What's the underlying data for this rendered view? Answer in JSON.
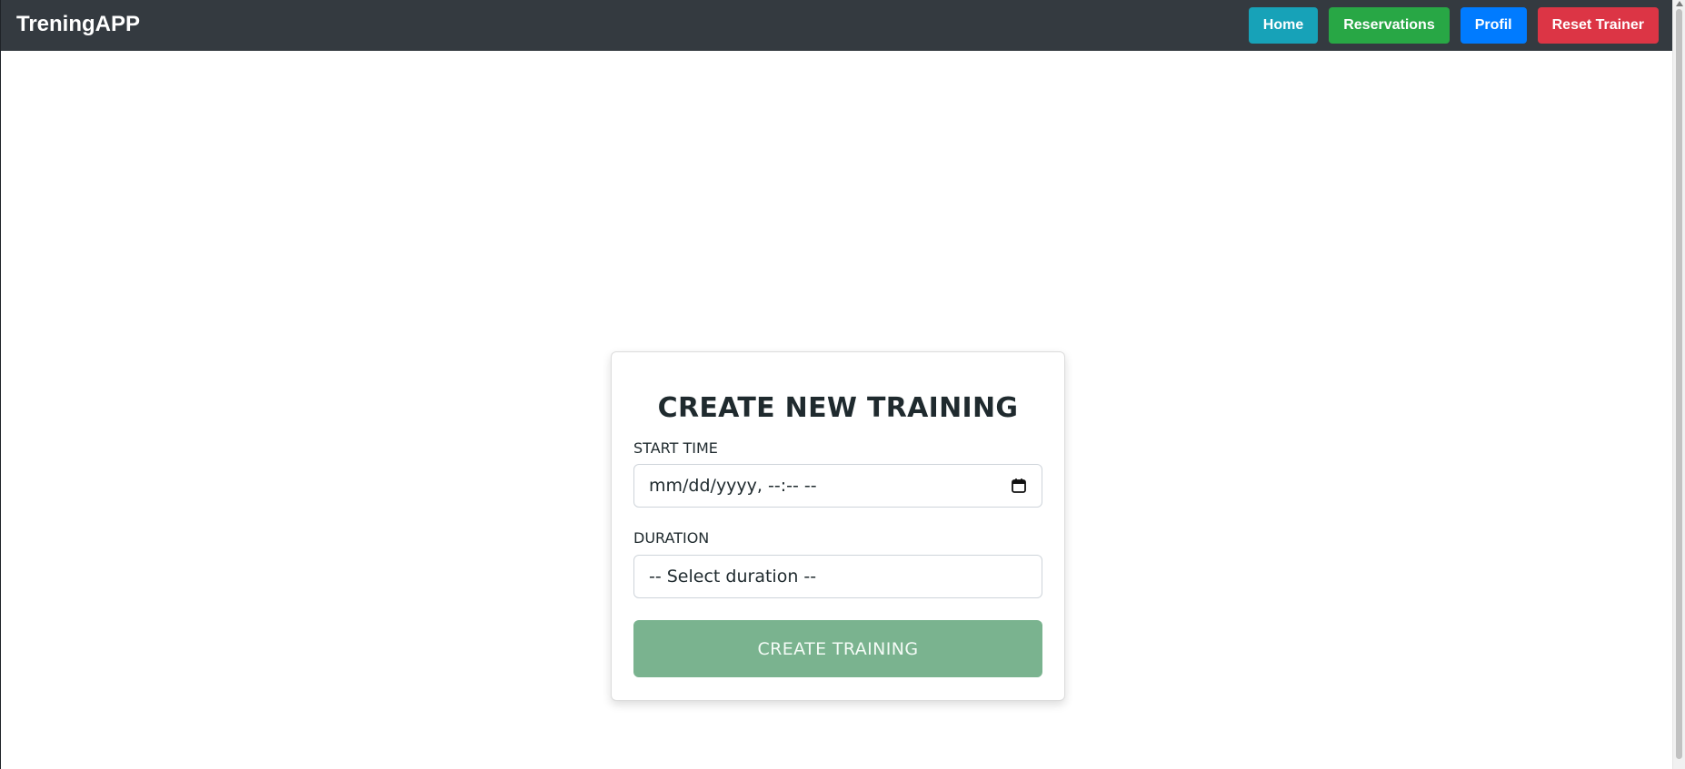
{
  "app": {
    "brand": "TreningAPP"
  },
  "navbar": {
    "buttons": [
      {
        "label": "Home",
        "color": "#17a2b8"
      },
      {
        "label": "Reservations",
        "color": "#28a745"
      },
      {
        "label": "Profil",
        "color": "#007bff"
      },
      {
        "label": "Reset Trainer",
        "color": "#dc3545"
      }
    ],
    "background": "#343a40"
  },
  "form": {
    "title": "CREATE NEW TRAINING",
    "start_time": {
      "label": "START TIME",
      "placeholder": "mm/dd/yyyy, --:-- --"
    },
    "duration": {
      "label": "DURATION",
      "selected": "-- Select duration --"
    },
    "submit_label": "CREATE TRAINING",
    "submit_color": "#7ab38f"
  },
  "icons": {
    "calendar": "calendar-icon"
  }
}
